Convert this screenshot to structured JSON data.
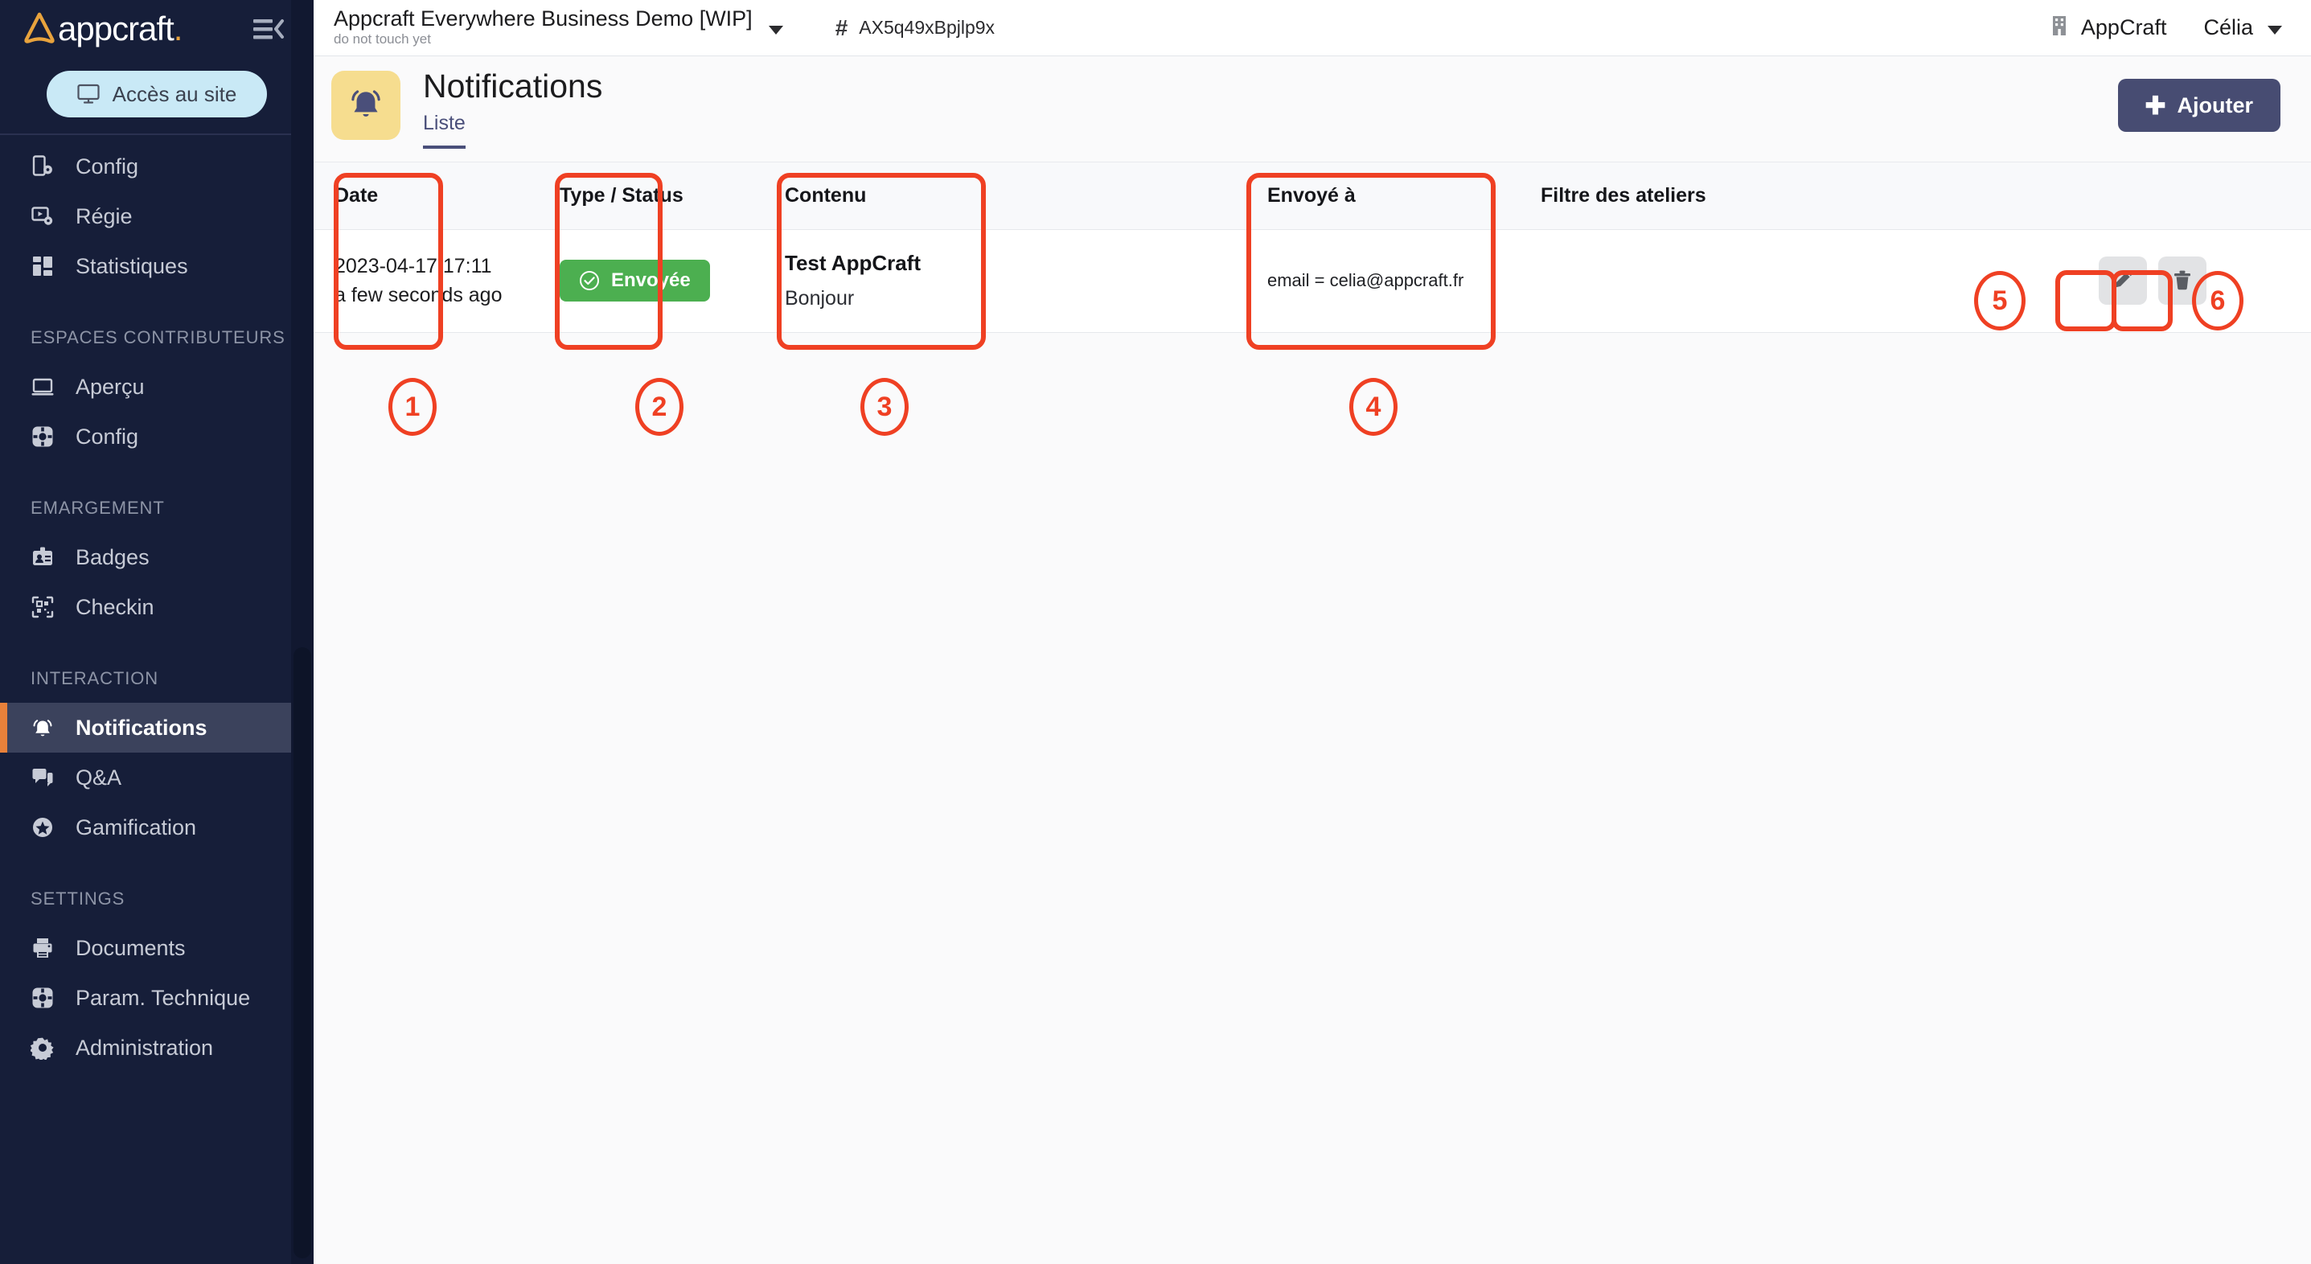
{
  "brand": {
    "word": "appcraft",
    "dot": ".",
    "logo_icon": "appcraft-triangle-logo",
    "collapse_icon": "collapse-sidebar-icon"
  },
  "sidebar": {
    "access_button_label": "Accès au site",
    "access_button_icon": "monitor-icon",
    "items": [
      {
        "label": "Config",
        "icon": "mobile-config-icon",
        "active": false,
        "section": null
      },
      {
        "label": "Régie",
        "icon": "video-settings-icon",
        "active": false,
        "section": null
      },
      {
        "label": "Statistiques",
        "icon": "dashboard-icon",
        "active": false,
        "section": null
      },
      {
        "label": "Aperçu",
        "icon": "laptop-icon",
        "active": false,
        "section": "ESPACES CONTRIBUTEURS"
      },
      {
        "label": "Config",
        "icon": "gear-round-icon",
        "active": false,
        "section": null
      },
      {
        "label": "Badges",
        "icon": "badge-icon",
        "active": false,
        "section": "EMARGEMENT"
      },
      {
        "label": "Checkin",
        "icon": "qrcode-icon",
        "active": false,
        "section": null
      },
      {
        "label": "Notifications",
        "icon": "bell-icon",
        "active": true,
        "section": "INTERACTION"
      },
      {
        "label": "Q&A",
        "icon": "chat-icon",
        "active": false,
        "section": null
      },
      {
        "label": "Gamification",
        "icon": "star-badge-icon",
        "active": false,
        "section": null
      },
      {
        "label": "Documents",
        "icon": "printer-icon",
        "active": false,
        "section": "SETTINGS"
      },
      {
        "label": "Param. Technique",
        "icon": "gear-round-icon",
        "active": false,
        "section": null
      },
      {
        "label": "Administration",
        "icon": "gear-icon",
        "active": false,
        "section": null
      }
    ]
  },
  "topbar": {
    "project_title": "Appcraft Everywhere Business Demo [WIP]",
    "project_subtitle": "do not touch yet",
    "project_caret_icon": "chevron-down-icon",
    "hash_symbol": "#",
    "project_id": "AX5q49xBpjlp9x",
    "org_icon": "building-icon",
    "org_name": "AppCraft",
    "user_name": "Célia",
    "user_caret_icon": "chevron-down-icon"
  },
  "page": {
    "icon": "bell-icon",
    "title": "Notifications",
    "tabs": [
      {
        "label": "Liste",
        "active": true
      }
    ],
    "add_button_label": "Ajouter",
    "add_button_icon": "plus-icon"
  },
  "table": {
    "columns": [
      {
        "key": "date",
        "label": "Date"
      },
      {
        "key": "type",
        "label": "Type / Status"
      },
      {
        "key": "content",
        "label": "Contenu"
      },
      {
        "key": "gap",
        "label": ""
      },
      {
        "key": "sentto",
        "label": "Envoyé à"
      },
      {
        "key": "filter",
        "label": "Filtre des ateliers"
      },
      {
        "key": "actions",
        "label": ""
      }
    ],
    "rows": [
      {
        "date_absolute": "2023-04-17 17:11",
        "date_relative": "a few seconds ago",
        "status_label": "Envoyée",
        "status_icon": "check-circle-icon",
        "status_color": "#4caf50",
        "content_title": "Test AppCraft",
        "content_body": "Bonjour",
        "sent_to": "email = celia@appcraft.fr",
        "filter": "",
        "actions": [
          {
            "name": "edit",
            "icon": "pencil-icon"
          },
          {
            "name": "delete",
            "icon": "trash-icon"
          }
        ]
      }
    ]
  },
  "annotations": {
    "color": "#ef4023",
    "markers": [
      {
        "number": "1",
        "target": "date-column"
      },
      {
        "number": "2",
        "target": "type-status-column"
      },
      {
        "number": "3",
        "target": "contenu-column"
      },
      {
        "number": "4",
        "target": "envoye-a-column"
      },
      {
        "number": "5",
        "target": "edit-button"
      },
      {
        "number": "6",
        "target": "delete-button"
      }
    ]
  }
}
